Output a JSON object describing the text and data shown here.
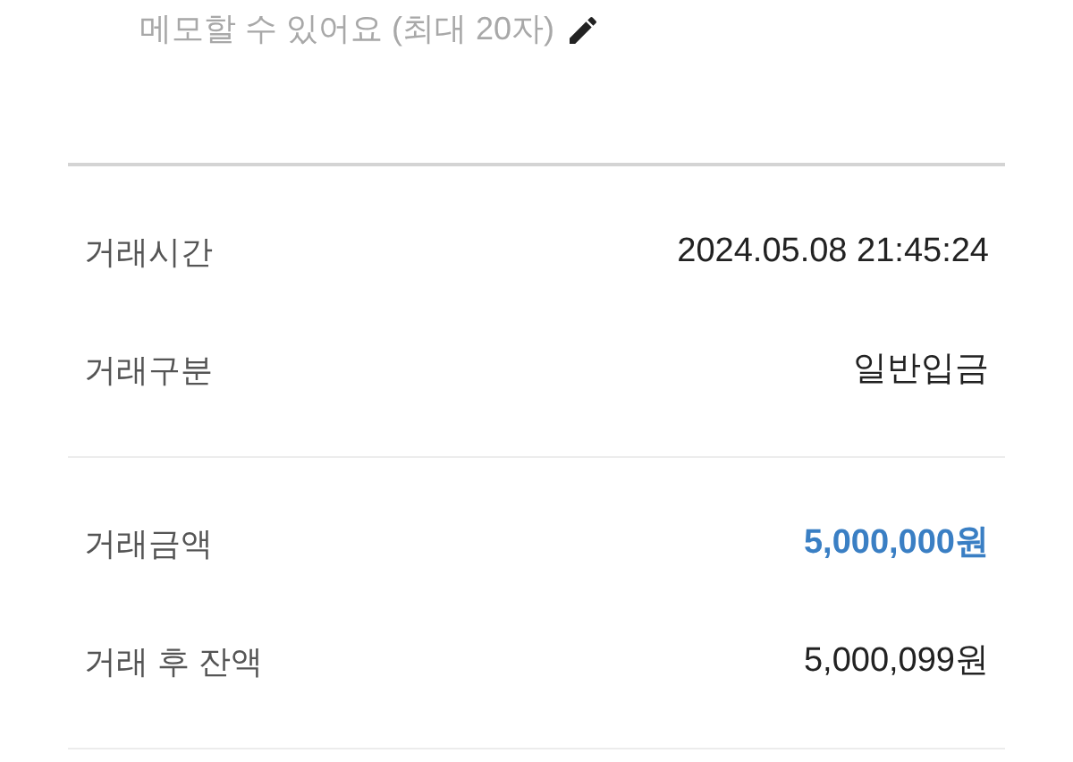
{
  "memo": {
    "placeholder": "메모할 수 있어요 (최대 20자)"
  },
  "sections": [
    {
      "rows": [
        {
          "label": "거래시간",
          "value": "2024.05.08 21:45:24",
          "kind": "plain"
        },
        {
          "label": "거래구분",
          "value": "일반입금",
          "kind": "plain"
        }
      ]
    },
    {
      "rows": [
        {
          "label": "거래금액",
          "value": "5,000,000원",
          "kind": "highlight"
        },
        {
          "label": "거래 후 잔액",
          "value": "5,000,099원",
          "kind": "plain"
        }
      ]
    }
  ]
}
